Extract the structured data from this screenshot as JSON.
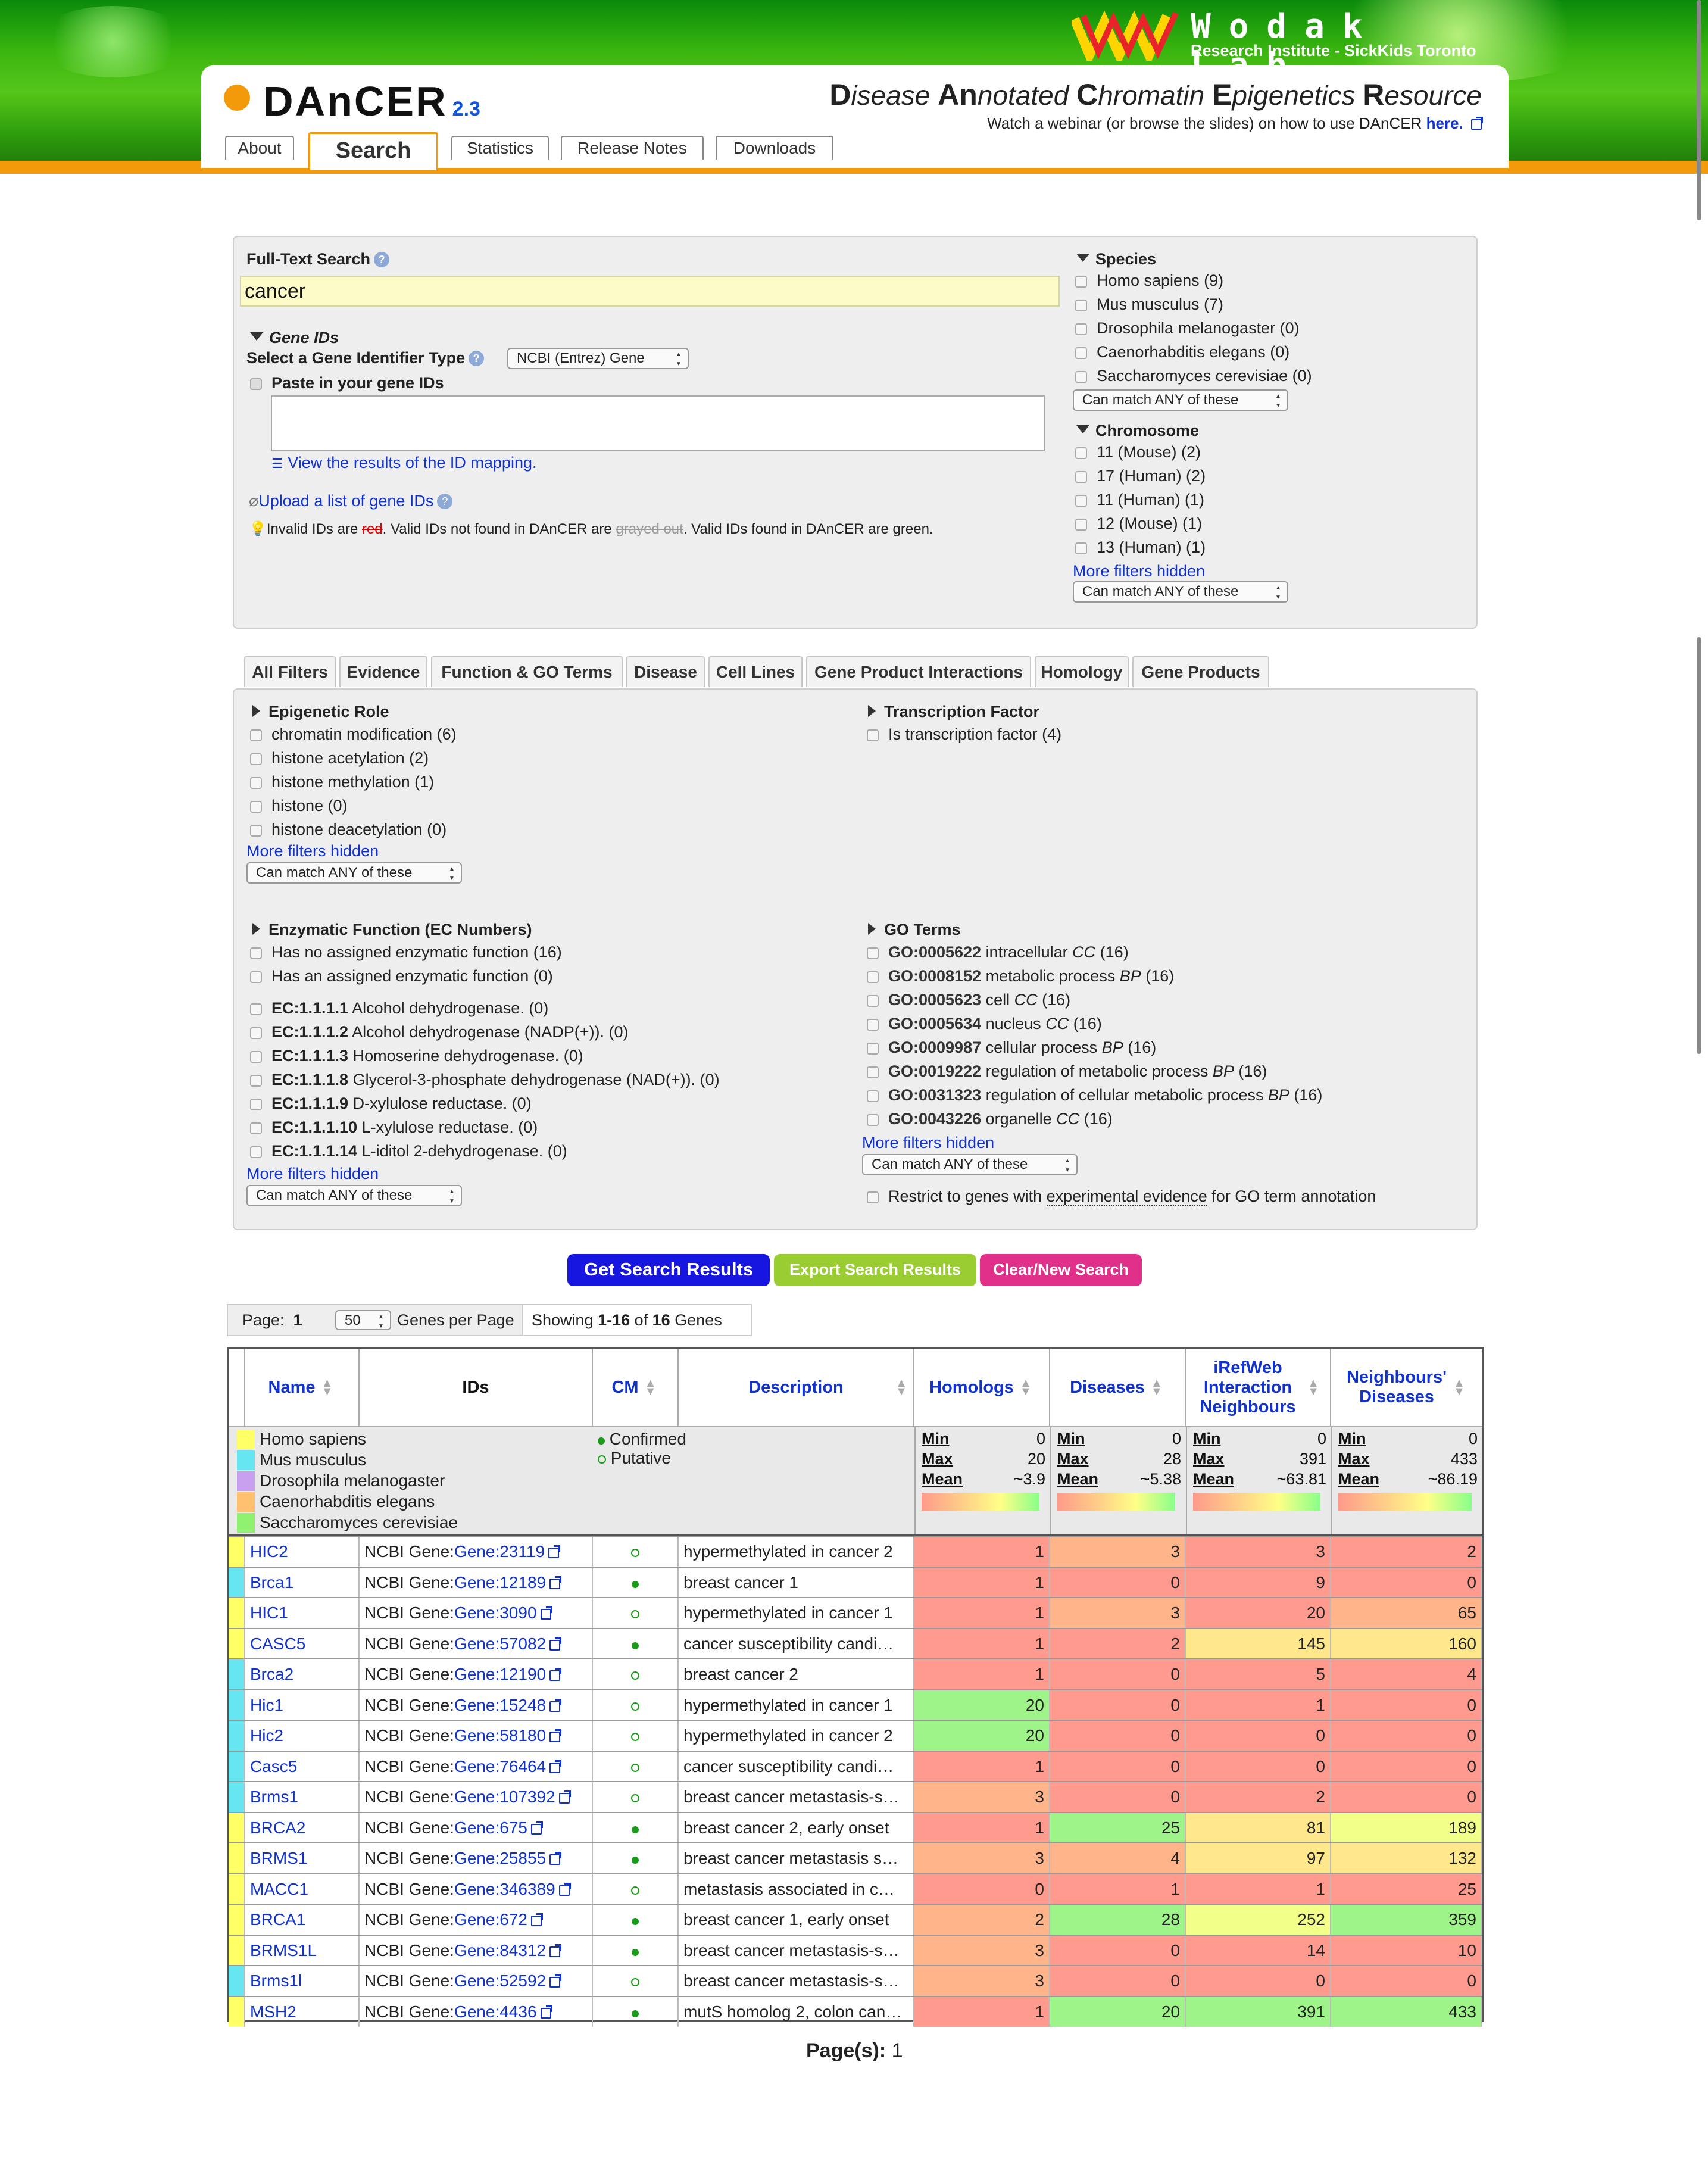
{
  "lab": {
    "name": "Wodak Lab",
    "subtitle": "Research Institute - SickKids Toronto"
  },
  "app": {
    "name": "DAnCER",
    "version": "2.3",
    "tagline": [
      {
        "cap": "D",
        "rest": "isease "
      },
      {
        "cap": "An",
        "rest": "notated "
      },
      {
        "cap": "C",
        "rest": "hromatin "
      },
      {
        "cap": "E",
        "rest": "pigenetics "
      },
      {
        "cap": "R",
        "rest": "esource"
      }
    ],
    "webinar_text": "Watch a webinar (or browse the slides) on how to use DAnCER",
    "webinar_link": "here."
  },
  "nav_tabs": [
    "About",
    "Search",
    "Statistics",
    "Release Notes",
    "Downloads"
  ],
  "search": {
    "fts_label": "Full-Text Search",
    "fts_value": "cancer",
    "gene_ids_label": "Gene IDs",
    "id_type_label": "Select a Gene Identifier Type",
    "id_type_value": "NCBI (Entrez) Gene",
    "paste_label": "Paste in your gene IDs",
    "view_mapping": "View the results of the ID mapping.",
    "upload": "Upload a list of gene IDs",
    "hint": {
      "a": "Invalid IDs are ",
      "red": "red",
      "b": ". Valid IDs not found in DAnCER are ",
      "gray": "grayed out",
      "c": ". Valid IDs found in DAnCER are green."
    }
  },
  "species": {
    "label": "Species",
    "items": [
      "Homo sapiens (9)",
      "Mus musculus (7)",
      "Drosophila melanogaster (0)",
      "Caenorhabditis elegans (0)",
      "Saccharomyces cerevisiae (0)"
    ],
    "match": "Can match ANY of these"
  },
  "chromosome": {
    "label": "Chromosome",
    "items": [
      "11 (Mouse) (2)",
      "17 (Human) (2)",
      "11 (Human) (1)",
      "12 (Mouse) (1)",
      "13 (Human) (1)"
    ],
    "more": "More filters hidden",
    "match": "Can match ANY of these"
  },
  "filter_tabs": [
    "All Filters",
    "Evidence",
    "Function & GO Terms",
    "Disease",
    "Cell Lines",
    "Gene Product Interactions",
    "Homology",
    "Gene Products"
  ],
  "epigenetic": {
    "label": "Epigenetic Role",
    "items": [
      "chromatin modification (6)",
      "histone acetylation (2)",
      "histone methylation (1)",
      "histone (0)",
      "histone deacetylation (0)"
    ],
    "more": "More filters hidden",
    "match": "Can match ANY of these"
  },
  "tf": {
    "label": "Transcription Factor",
    "items": [
      "Is transcription factor (4)"
    ]
  },
  "enzymatic": {
    "label": "Enzymatic Function (EC Numbers)",
    "plain": [
      "Has no assigned enzymatic function (16)",
      "Has an assigned enzymatic function (0)"
    ],
    "ec": [
      {
        "code": "EC:1.1.1.1",
        "text": " Alcohol dehydrogenase. (0)"
      },
      {
        "code": "EC:1.1.1.2",
        "text": " Alcohol dehydrogenase (NADP(+)). (0)"
      },
      {
        "code": "EC:1.1.1.3",
        "text": " Homoserine dehydrogenase. (0)"
      },
      {
        "code": "EC:1.1.1.8",
        "text": " Glycerol-3-phosphate dehydrogenase (NAD(+)). (0)"
      },
      {
        "code": "EC:1.1.1.9",
        "text": " D-xylulose reductase. (0)"
      },
      {
        "code": "EC:1.1.1.10",
        "text": " L-xylulose reductase. (0)"
      },
      {
        "code": "EC:1.1.1.14",
        "text": " L-iditol 2-dehydrogenase. (0)"
      }
    ],
    "more": "More filters hidden",
    "match": "Can match ANY of these"
  },
  "go": {
    "label": "GO Terms",
    "items": [
      {
        "id": "GO:0005622",
        "name": " intracellular ",
        "ns": "CC",
        "count": " (16)"
      },
      {
        "id": "GO:0008152",
        "name": " metabolic process ",
        "ns": "BP",
        "count": " (16)"
      },
      {
        "id": "GO:0005623",
        "name": " cell ",
        "ns": "CC",
        "count": " (16)"
      },
      {
        "id": "GO:0005634",
        "name": " nucleus ",
        "ns": "CC",
        "count": " (16)"
      },
      {
        "id": "GO:0009987",
        "name": " cellular process ",
        "ns": "BP",
        "count": " (16)"
      },
      {
        "id": "GO:0019222",
        "name": " regulation of metabolic process ",
        "ns": "BP",
        "count": " (16)"
      },
      {
        "id": "GO:0031323",
        "name": " regulation of cellular metabolic process ",
        "ns": "BP",
        "count": " (16)"
      },
      {
        "id": "GO:0043226",
        "name": " organelle ",
        "ns": "CC",
        "count": " (16)"
      }
    ],
    "more": "More filters hidden",
    "match": "Can match ANY of these",
    "restrict_a": "Restrict to genes with ",
    "restrict_u": "experimental evidence",
    "restrict_b": " for GO term annotation"
  },
  "buttons": {
    "get": "Get Search Results",
    "export": "Export Search Results",
    "clear": "Clear/New Search"
  },
  "colors": {
    "get": "#1616e0",
    "export": "#9acd32",
    "clear": "#e0308a",
    "human": "#ffff66",
    "mouse": "#66e6f0",
    "fly": "#c8a0f0",
    "worm": "#ffc070",
    "yeast": "#90f070"
  },
  "paging": {
    "page_label": "Page:",
    "page": "1",
    "per_page": "50",
    "per_page_label": "Genes per Page",
    "showing_a": "Showing ",
    "range": "1-16",
    "of": " of ",
    "total": "16",
    "genes": " Genes",
    "pages_label": "Page(s):",
    "pages": "1"
  },
  "table": {
    "headers": {
      "name": "Name",
      "ids": "IDs",
      "cm": "CM",
      "desc": "Description",
      "hom": "Homologs",
      "dis": "Diseases",
      "iref": "iRefWeb Interaction Neighbours",
      "nbr": "Neighbours' Diseases"
    },
    "legend_species": [
      "Homo sapiens",
      "Mus musculus",
      "Drosophila melanogaster",
      "Caenorhabditis elegans",
      "Saccharomyces cerevisiae"
    ],
    "legend_cm": [
      "Confirmed",
      "Putative"
    ],
    "stats": [
      {
        "min": "0",
        "max": "20",
        "mean": "~3.9"
      },
      {
        "min": "0",
        "max": "28",
        "mean": "~5.38"
      },
      {
        "min": "0",
        "max": "391",
        "mean": "~63.81"
      },
      {
        "min": "0",
        "max": "433",
        "mean": "~86.19"
      }
    ],
    "stat_labels": {
      "min": "Min",
      "max": "Max",
      "mean": "Mean"
    },
    "rows": [
      {
        "sp": "human",
        "name": "HIC2",
        "idp": "NCBI Gene:",
        "id": "Gene:23119",
        "cm": "putative",
        "desc": "hypermethylated in cancer 2",
        "h": "1",
        "d": "3",
        "i": "3",
        "n": "2"
      },
      {
        "sp": "mouse",
        "name": "Brca1",
        "idp": "NCBI Gene:",
        "id": "Gene:12189",
        "cm": "confirmed",
        "desc": "breast cancer 1",
        "h": "1",
        "d": "0",
        "i": "9",
        "n": "0"
      },
      {
        "sp": "human",
        "name": "HIC1",
        "idp": "NCBI Gene:",
        "id": "Gene:3090",
        "cm": "putative",
        "desc": "hypermethylated in cancer 1",
        "h": "1",
        "d": "3",
        "i": "20",
        "n": "65"
      },
      {
        "sp": "human",
        "name": "CASC5",
        "idp": "NCBI Gene:",
        "id": "Gene:57082",
        "cm": "confirmed",
        "desc": "cancer susceptibility candi…",
        "h": "1",
        "d": "2",
        "i": "145",
        "n": "160"
      },
      {
        "sp": "mouse",
        "name": "Brca2",
        "idp": "NCBI Gene:",
        "id": "Gene:12190",
        "cm": "putative",
        "desc": "breast cancer 2",
        "h": "1",
        "d": "0",
        "i": "5",
        "n": "4"
      },
      {
        "sp": "mouse",
        "name": "Hic1",
        "idp": "NCBI Gene:",
        "id": "Gene:15248",
        "cm": "putative",
        "desc": "hypermethylated in cancer 1",
        "h": "20",
        "d": "0",
        "i": "1",
        "n": "0"
      },
      {
        "sp": "mouse",
        "name": "Hic2",
        "idp": "NCBI Gene:",
        "id": "Gene:58180",
        "cm": "putative",
        "desc": "hypermethylated in cancer 2",
        "h": "20",
        "d": "0",
        "i": "0",
        "n": "0"
      },
      {
        "sp": "mouse",
        "name": "Casc5",
        "idp": "NCBI Gene:",
        "id": "Gene:76464",
        "cm": "putative",
        "desc": "cancer susceptibility candi…",
        "h": "1",
        "d": "0",
        "i": "0",
        "n": "0"
      },
      {
        "sp": "mouse",
        "name": "Brms1",
        "idp": "NCBI Gene:",
        "id": "Gene:107392",
        "cm": "putative",
        "desc": "breast cancer metastasis-s…",
        "h": "3",
        "d": "0",
        "i": "2",
        "n": "0"
      },
      {
        "sp": "human",
        "name": "BRCA2",
        "idp": "NCBI Gene:",
        "id": "Gene:675",
        "cm": "confirmed",
        "desc": "breast cancer 2, early onset",
        "h": "1",
        "d": "25",
        "i": "81",
        "n": "189"
      },
      {
        "sp": "human",
        "name": "BRMS1",
        "idp": "NCBI Gene:",
        "id": "Gene:25855",
        "cm": "confirmed",
        "desc": "breast cancer metastasis s…",
        "h": "3",
        "d": "4",
        "i": "97",
        "n": "132"
      },
      {
        "sp": "human",
        "name": "MACC1",
        "idp": "NCBI Gene:",
        "id": "Gene:346389",
        "cm": "putative",
        "desc": "metastasis associated in c…",
        "h": "0",
        "d": "1",
        "i": "1",
        "n": "25"
      },
      {
        "sp": "human",
        "name": "BRCA1",
        "idp": "NCBI Gene:",
        "id": "Gene:672",
        "cm": "confirmed",
        "desc": "breast cancer 1, early onset",
        "h": "2",
        "d": "28",
        "i": "252",
        "n": "359"
      },
      {
        "sp": "human",
        "name": "BRMS1L",
        "idp": "NCBI Gene:",
        "id": "Gene:84312",
        "cm": "confirmed",
        "desc": "breast cancer metastasis-s…",
        "h": "3",
        "d": "0",
        "i": "14",
        "n": "10"
      },
      {
        "sp": "mouse",
        "name": "Brms1l",
        "idp": "NCBI Gene:",
        "id": "Gene:52592",
        "cm": "putative",
        "desc": "breast cancer metastasis-s…",
        "h": "3",
        "d": "0",
        "i": "0",
        "n": "0"
      },
      {
        "sp": "human",
        "name": "MSH2",
        "idp": "NCBI Gene:",
        "id": "Gene:4436",
        "cm": "confirmed",
        "desc": "mutS homolog 2, colon can…",
        "h": "1",
        "d": "20",
        "i": "391",
        "n": "433"
      }
    ]
  }
}
